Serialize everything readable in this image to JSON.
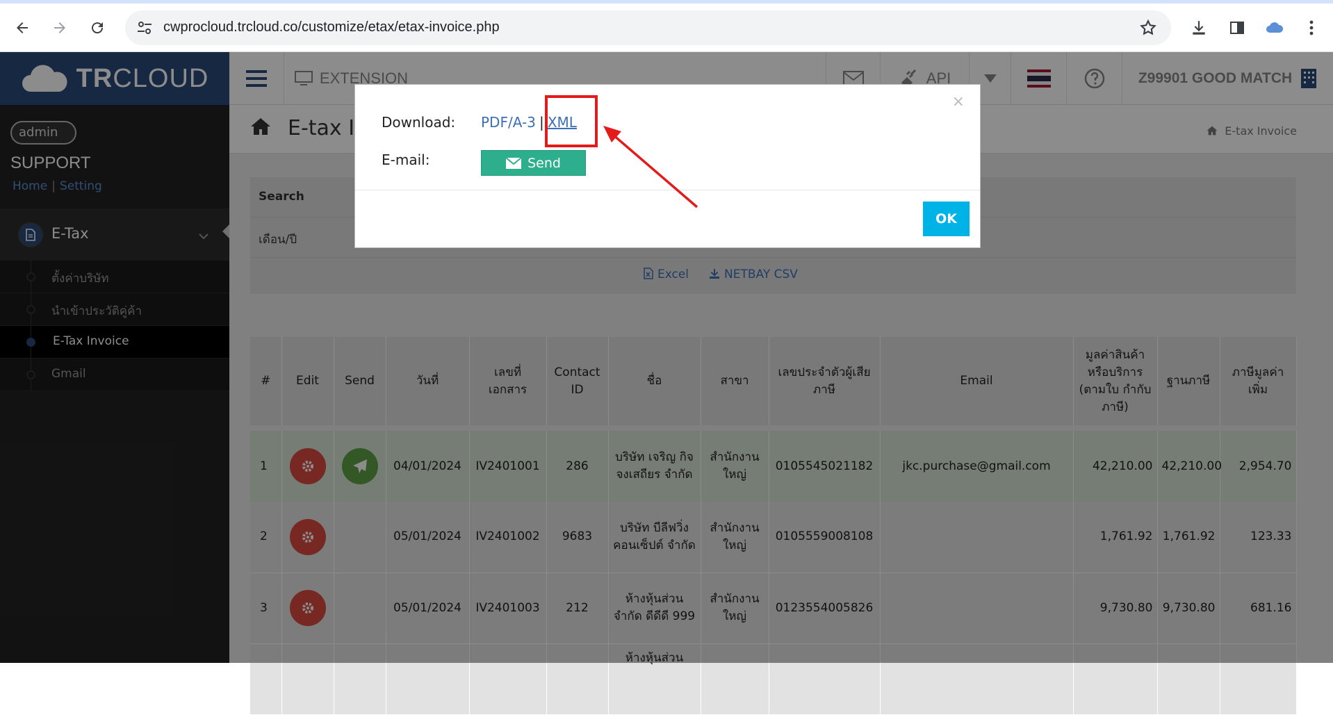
{
  "browser": {
    "url": "cwprocloud.trcloud.co/customize/etax/etax-invoice.php"
  },
  "sidebar": {
    "brand_main": "TR",
    "brand_sub": "CLOUD",
    "avatar_alt": "admin",
    "user_label": "SUPPORT",
    "link_home": "Home",
    "link_sep": "|",
    "link_setting": "Setting",
    "section": "E-Tax",
    "items": [
      {
        "label": "ตั้งค่าบริษัท"
      },
      {
        "label": "นำเข้าประวัติคู่ค้า"
      },
      {
        "label": "E-Tax Invoice"
      },
      {
        "label": "Gmail"
      }
    ]
  },
  "topnav": {
    "extension": "EXTENSION",
    "api": "API",
    "company": "Z99901 GOOD MATCH"
  },
  "page": {
    "title": "E-tax I",
    "breadcrumb": "E-tax Invoice"
  },
  "search": {
    "label": "Search",
    "month_year": "เดือน/ปี",
    "excel": "Excel",
    "netbay": "NETBAY CSV"
  },
  "table": {
    "headers": [
      "#",
      "Edit",
      "Send",
      "วันที่",
      "เลขที่ เอกสาร",
      "Contact ID",
      "ชื่อ",
      "สาขา",
      "เลขประจำตัวผู้เสีย ภาษี",
      "Email",
      "มูลค่าสินค้า หรือบริการ (ตามใบ กำกับภาษี)",
      "ฐานภาษี",
      "ภาษีมูลค่า เพิ่ม"
    ],
    "rows": [
      {
        "no": "1",
        "date": "04/01/2024",
        "doc": "IV2401001",
        "contact": "286",
        "name": "บริษัท เจริญ กิจจงเสถียร จำกัด",
        "branch": "สำนักงาน ใหญ่",
        "taxid": "0105545021182",
        "email": "jkc.purchase@gmail.com",
        "amount": "42,210.00",
        "base": "42,210.00",
        "vat": "2,954.70"
      },
      {
        "no": "2",
        "date": "05/01/2024",
        "doc": "IV2401002",
        "contact": "9683",
        "name": "บริษัท บีลีฟวิ่ง คอนเซ็ปต์ จำกัด",
        "branch": "สำนักงาน ใหญ่",
        "taxid": "0105559008108",
        "email": "",
        "amount": "1,761.92",
        "base": "1,761.92",
        "vat": "123.33"
      },
      {
        "no": "3",
        "date": "05/01/2024",
        "doc": "IV2401003",
        "contact": "212",
        "name": "ห้างหุ้นส่วน จำกัด ดีดีดี 999",
        "branch": "สำนักงาน ใหญ่",
        "taxid": "0123554005826",
        "email": "",
        "amount": "9,730.80",
        "base": "9,730.80",
        "vat": "681.16"
      },
      {
        "no": "",
        "date": "",
        "doc": "",
        "contact": "",
        "name": "ห้างหุ้นส่วน",
        "branch": "",
        "taxid": "",
        "email": "",
        "amount": "",
        "base": "",
        "vat": ""
      }
    ]
  },
  "modal": {
    "download_label": "Download:",
    "pdf_link": "PDF/A-3",
    "link_sep": "|",
    "xml_link": "XML",
    "email_label": "E-mail:",
    "send_label": "Send",
    "ok_label": "OK",
    "close": "×"
  },
  "colors": {
    "brand": "#2a4a7a",
    "send_green": "#2dae8c",
    "ok_blue": "#00b3e6",
    "highlight_red": "#e31b1b",
    "edit_red": "#d9493e",
    "send_circle_green": "#5ea145"
  }
}
